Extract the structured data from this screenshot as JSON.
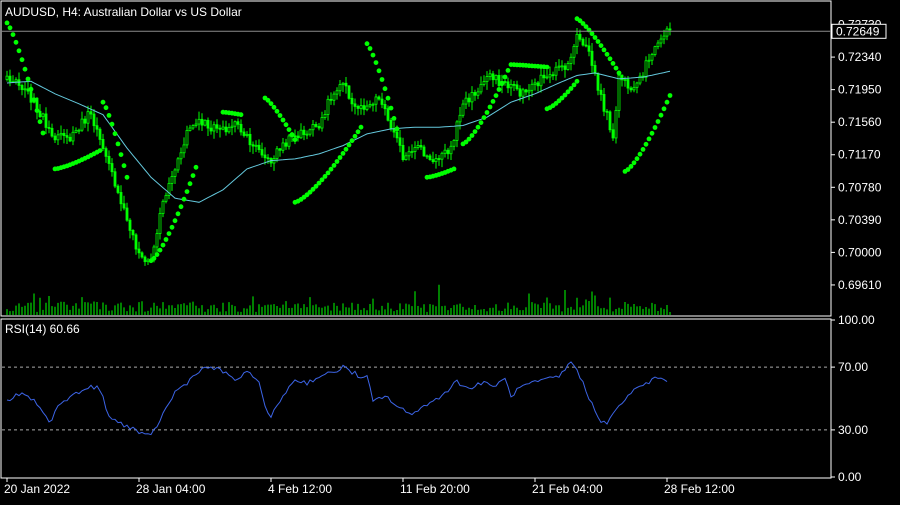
{
  "window": {
    "symbol_label": "AUDUSD, H4:  Australian Dollar vs US Dollar"
  },
  "colors": {
    "background": "#000000",
    "axis": "#ffffff",
    "bull_candle": "#00ff00",
    "bear_candle": "#00ff00",
    "moving_average": "#64c8dc",
    "parabolic_sar": "#00ff00",
    "volume": "#00ff00",
    "rsi_line": "#3c64e6",
    "rsi_levels": "#aaaaaa",
    "price_line": "#8c8c8c"
  },
  "chart_data": [
    {
      "type": "candlestick",
      "title": "AUDUSD, H4:  Australian Dollar vs US Dollar",
      "ylim": [
        0.6925,
        0.73
      ],
      "y_ticks": [
        "0.72730",
        "0.72340",
        "0.71950",
        "0.71560",
        "0.71170",
        "0.70780",
        "0.70390",
        "0.70000",
        "0.69610"
      ],
      "current_price": 0.72649,
      "current_price_label": "0.72649",
      "x_tick_labels": [
        "20 Jan 2022",
        "28 Jan 04:00",
        "4 Feb 12:00",
        "11 Feb 20:00",
        "21 Feb 04:00",
        "28 Feb 12:00"
      ],
      "x_tick_bars": [
        0,
        44,
        88,
        132,
        176,
        220
      ],
      "bar_count": 222,
      "close_anchors": [
        [
          0,
          0.721
        ],
        [
          4,
          0.7198
        ],
        [
          8,
          0.7185
        ],
        [
          12,
          0.716
        ],
        [
          16,
          0.714
        ],
        [
          20,
          0.7135
        ],
        [
          24,
          0.715
        ],
        [
          28,
          0.717
        ],
        [
          32,
          0.712
        ],
        [
          36,
          0.7085
        ],
        [
          40,
          0.704
        ],
        [
          44,
          0.6995
        ],
        [
          48,
          0.699
        ],
        [
          52,
          0.706
        ],
        [
          56,
          0.71
        ],
        [
          60,
          0.7145
        ],
        [
          64,
          0.716
        ],
        [
          68,
          0.715
        ],
        [
          72,
          0.7145
        ],
        [
          76,
          0.7155
        ],
        [
          80,
          0.714
        ],
        [
          84,
          0.712
        ],
        [
          88,
          0.711
        ],
        [
          92,
          0.713
        ],
        [
          96,
          0.714
        ],
        [
          100,
          0.7145
        ],
        [
          104,
          0.7155
        ],
        [
          108,
          0.7185
        ],
        [
          112,
          0.72
        ],
        [
          116,
          0.7175
        ],
        [
          120,
          0.717
        ],
        [
          124,
          0.7185
        ],
        [
          128,
          0.715
        ],
        [
          132,
          0.7115
        ],
        [
          136,
          0.713
        ],
        [
          140,
          0.7115
        ],
        [
          144,
          0.711
        ],
        [
          148,
          0.7125
        ],
        [
          152,
          0.718
        ],
        [
          156,
          0.719
        ],
        [
          160,
          0.721
        ],
        [
          164,
          0.7205
        ],
        [
          168,
          0.72
        ],
        [
          172,
          0.719
        ],
        [
          176,
          0.72
        ],
        [
          180,
          0.7215
        ],
        [
          184,
          0.722
        ],
        [
          188,
          0.723
        ],
        [
          190,
          0.7265
        ],
        [
          194,
          0.724
        ],
        [
          198,
          0.7185
        ],
        [
          202,
          0.714
        ],
        [
          204,
          0.721
        ],
        [
          208,
          0.72
        ],
        [
          212,
          0.7215
        ],
        [
          216,
          0.725
        ],
        [
          221,
          0.7265
        ]
      ],
      "moving_average_anchors": [
        [
          0,
          0.7203
        ],
        [
          8,
          0.7205
        ],
        [
          16,
          0.719
        ],
        [
          24,
          0.7178
        ],
        [
          32,
          0.7165
        ],
        [
          40,
          0.7125
        ],
        [
          48,
          0.709
        ],
        [
          56,
          0.7065
        ],
        [
          64,
          0.706
        ],
        [
          72,
          0.7075
        ],
        [
          80,
          0.71
        ],
        [
          88,
          0.711
        ],
        [
          96,
          0.7112
        ],
        [
          104,
          0.7118
        ],
        [
          112,
          0.7128
        ],
        [
          120,
          0.7142
        ],
        [
          128,
          0.7148
        ],
        [
          136,
          0.715
        ],
        [
          144,
          0.715
        ],
        [
          152,
          0.7152
        ],
        [
          160,
          0.7162
        ],
        [
          168,
          0.718
        ],
        [
          176,
          0.719
        ],
        [
          184,
          0.7203
        ],
        [
          190,
          0.7212
        ],
        [
          196,
          0.7215
        ],
        [
          204,
          0.7208
        ],
        [
          212,
          0.721
        ],
        [
          221,
          0.7217
        ]
      ],
      "parabolic_sar_segments": [
        {
          "from_bar": 0,
          "to_bar": 12,
          "start": 0.7275,
          "end": 0.7143
        },
        {
          "from_bar": 16,
          "to_bar": 31,
          "start": 0.71,
          "end": 0.7122
        },
        {
          "from_bar": 32,
          "to_bar": 40,
          "start": 0.718,
          "end": 0.709
        },
        {
          "from_bar": 48,
          "to_bar": 63,
          "start": 0.699,
          "end": 0.7102
        },
        {
          "from_bar": 72,
          "to_bar": 78,
          "start": 0.7168,
          "end": 0.7165
        },
        {
          "from_bar": 86,
          "to_bar": 96,
          "start": 0.7185,
          "end": 0.7135
        },
        {
          "from_bar": 96,
          "to_bar": 118,
          "start": 0.706,
          "end": 0.715
        },
        {
          "from_bar": 120,
          "to_bar": 130,
          "start": 0.725,
          "end": 0.7148
        },
        {
          "from_bar": 140,
          "to_bar": 149,
          "start": 0.709,
          "end": 0.71
        },
        {
          "from_bar": 152,
          "to_bar": 167,
          "start": 0.713,
          "end": 0.7218
        },
        {
          "from_bar": 168,
          "to_bar": 180,
          "start": 0.7225,
          "end": 0.7222
        },
        {
          "from_bar": 180,
          "to_bar": 190,
          "start": 0.7172,
          "end": 0.7205
        },
        {
          "from_bar": 190,
          "to_bar": 204,
          "start": 0.728,
          "end": 0.7215
        },
        {
          "from_bar": 206,
          "to_bar": 221,
          "start": 0.7097,
          "end": 0.7188
        }
      ]
    },
    {
      "type": "line",
      "title": "RSI(14) 60.66",
      "ylim": [
        0,
        100
      ],
      "y_ticks": [
        "100.00",
        "70.00",
        "30.00",
        "0.00"
      ],
      "levels": [
        70,
        30
      ],
      "anchors": [
        [
          0,
          48
        ],
        [
          4,
          53
        ],
        [
          8,
          50
        ],
        [
          12,
          42
        ],
        [
          14,
          34
        ],
        [
          18,
          48
        ],
        [
          22,
          52
        ],
        [
          26,
          56
        ],
        [
          30,
          58
        ],
        [
          32,
          50
        ],
        [
          34,
          38
        ],
        [
          38,
          34
        ],
        [
          42,
          31
        ],
        [
          46,
          26
        ],
        [
          48,
          26
        ],
        [
          52,
          40
        ],
        [
          56,
          54
        ],
        [
          60,
          60
        ],
        [
          64,
          68
        ],
        [
          68,
          70
        ],
        [
          72,
          67
        ],
        [
          76,
          62
        ],
        [
          80,
          66
        ],
        [
          84,
          62
        ],
        [
          86,
          44
        ],
        [
          88,
          38
        ],
        [
          92,
          52
        ],
        [
          96,
          62
        ],
        [
          100,
          60
        ],
        [
          104,
          64
        ],
        [
          108,
          66
        ],
        [
          112,
          70
        ],
        [
          116,
          66
        ],
        [
          118,
          62
        ],
        [
          120,
          64
        ],
        [
          122,
          48
        ],
        [
          126,
          52
        ],
        [
          130,
          45
        ],
        [
          134,
          40
        ],
        [
          138,
          44
        ],
        [
          142,
          48
        ],
        [
          146,
          54
        ],
        [
          150,
          61
        ],
        [
          154,
          56
        ],
        [
          158,
          60
        ],
        [
          162,
          58
        ],
        [
          166,
          62
        ],
        [
          168,
          52
        ],
        [
          172,
          58
        ],
        [
          176,
          60
        ],
        [
          180,
          62
        ],
        [
          184,
          64
        ],
        [
          188,
          73
        ],
        [
          190,
          69
        ],
        [
          194,
          50
        ],
        [
          198,
          36
        ],
        [
          200,
          34
        ],
        [
          204,
          45
        ],
        [
          208,
          54
        ],
        [
          212,
          58
        ],
        [
          216,
          63
        ],
        [
          220,
          62
        ]
      ]
    }
  ]
}
